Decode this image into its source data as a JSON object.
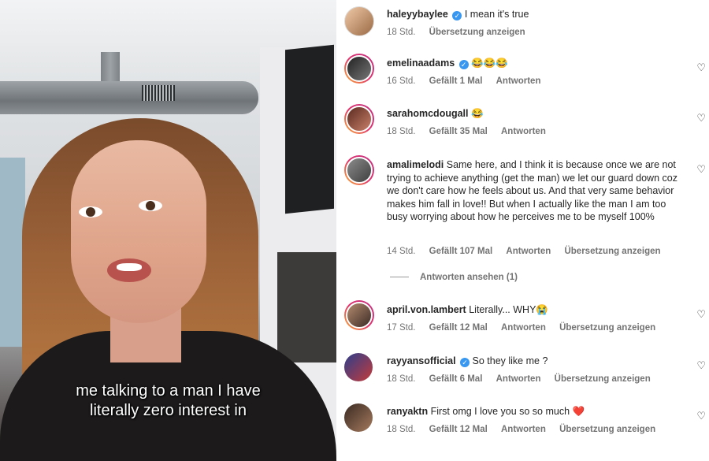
{
  "video": {
    "caption_line1": "me talking to a man I have",
    "caption_line2": "literally zero interest in"
  },
  "comments": [
    {
      "user": "haleyybaylee",
      "verified": true,
      "text": "I mean it's true",
      "time": "18 Std.",
      "likes": "",
      "reply": "",
      "translate": "Übersetzung anzeigen"
    },
    {
      "user": "emelinaadams",
      "verified": true,
      "text": "😂😂😂",
      "time": "16 Std.",
      "likes": "Gefällt 1 Mal",
      "reply": "Antworten",
      "translate": ""
    },
    {
      "user": "sarahomcdougall",
      "verified": false,
      "text": "😂",
      "time": "18 Std.",
      "likes": "Gefällt 35 Mal",
      "reply": "Antworten",
      "translate": ""
    },
    {
      "user": "amalimelodi",
      "verified": false,
      "text": "Same here, and I think it is because once we are not trying to achieve anything (get the man) we let our guard down coz we don't care how he feels about us. And that very same behavior makes him fall in love!! But when I actually like the man I am too busy worrying about how he perceives me to be myself 100%",
      "time": "14 Std.",
      "likes": "Gefällt 107 Mal",
      "reply": "Antworten",
      "translate": "Übersetzung anzeigen"
    },
    {
      "user": "april.von.lambert",
      "verified": false,
      "text": "Literally... WHY😭",
      "time": "17 Std.",
      "likes": "Gefällt 12 Mal",
      "reply": "Antworten",
      "translate": "Übersetzung anzeigen"
    },
    {
      "user": "rayyansofficial",
      "verified": true,
      "text": "So they like me ?",
      "time": "18 Std.",
      "likes": "Gefällt 6 Mal",
      "reply": "Antworten",
      "translate": "Übersetzung anzeigen"
    },
    {
      "user": "ranyaktn",
      "verified": false,
      "text": "First omg I love you so so much ❤️",
      "time": "18 Std.",
      "likes": "Gefällt 12 Mal",
      "reply": "Antworten",
      "translate": "Übersetzung anzeigen"
    }
  ],
  "view_replies": "Antworten ansehen (1)",
  "icons": {
    "heart": "heart-icon",
    "verified": "verified-badge-icon"
  },
  "colors": {
    "verified": "#3897f0",
    "meta": "#737373",
    "text": "#262626"
  }
}
